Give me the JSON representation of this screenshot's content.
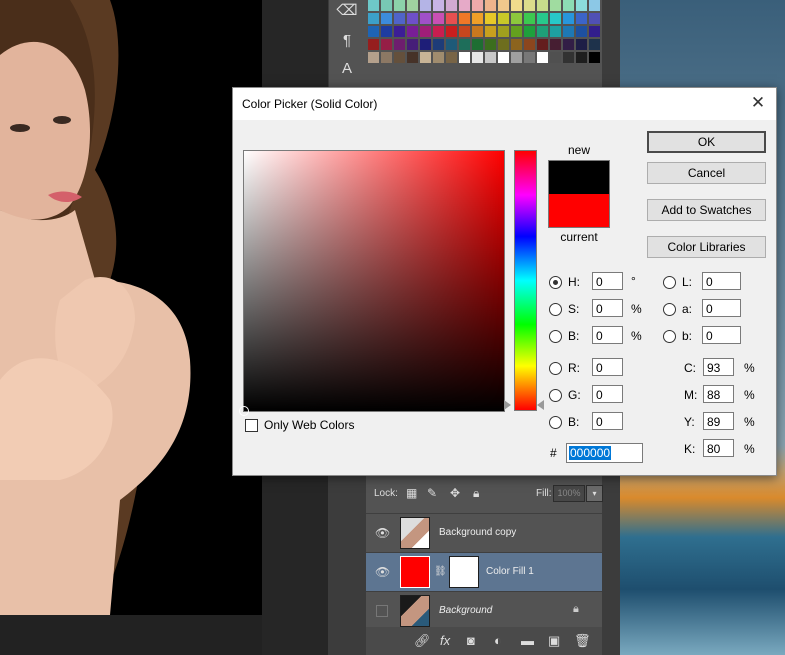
{
  "dialog": {
    "title": "Color Picker (Solid Color)",
    "ok_label": "OK",
    "cancel_label": "Cancel",
    "add_swatches_label": "Add to Swatches",
    "color_libraries_label": "Color Libraries",
    "new_label": "new",
    "current_label": "current",
    "new_color": "#000000",
    "current_color": "#ff0000",
    "only_web_colors_label": "Only Web Colors",
    "only_web_colors_checked": false,
    "hex_hash": "#",
    "hex_value": "000000",
    "selected_mode": "H",
    "hsb": {
      "h_label": "H:",
      "h_value": "0",
      "h_unit": "°",
      "s_label": "S:",
      "s_value": "0",
      "s_unit": "%",
      "b_label": "B:",
      "b_value": "0",
      "b_unit": "%"
    },
    "rgb": {
      "r_label": "R:",
      "r_value": "0",
      "g_label": "G:",
      "g_value": "0",
      "b_label": "B:",
      "b_value": "0"
    },
    "lab": {
      "l_label": "L:",
      "l_value": "0",
      "a_label": "a:",
      "a_value": "0",
      "b_label": "b:",
      "b_value": "0"
    },
    "cmyk": {
      "c_label": "C:",
      "c_value": "93",
      "m_label": "M:",
      "m_value": "88",
      "y_label": "Y:",
      "y_value": "89",
      "k_label": "K:",
      "k_value": "80",
      "unit": "%"
    }
  },
  "layers": {
    "lock_label": "Lock:",
    "fill_label": "Fill:",
    "fill_value": "100%",
    "items": [
      {
        "name": "Background copy",
        "visible": true,
        "selected": false
      },
      {
        "name": "Color Fill 1",
        "visible": true,
        "selected": true,
        "fill_color": "#ff0000"
      },
      {
        "name": "Background",
        "visible": false,
        "selected": false,
        "locked": true
      }
    ]
  },
  "footer_icons": [
    "link-icon",
    "fx-icon",
    "mask-icon",
    "adjustment-icon",
    "folder-icon",
    "new-layer-icon",
    "trash-icon"
  ],
  "swatches": [
    "#6ec8c8",
    "#78c8b4",
    "#8cd2aa",
    "#a0d2a0",
    "#b4b4e6",
    "#c8b4e6",
    "#d2aad2",
    "#e6aac8",
    "#f0aaaa",
    "#f0b48c",
    "#f0c88c",
    "#f0dc8c",
    "#dcdc8c",
    "#c8dc8c",
    "#a0dca0",
    "#8cdcb4",
    "#8cdcdc",
    "#8cc8e6",
    "#3ca0c8",
    "#3c8cdc",
    "#5064c8",
    "#6e50c8",
    "#a050c8",
    "#c850b4",
    "#e65050",
    "#f07828",
    "#f0a028",
    "#e6c828",
    "#c8c828",
    "#8cc83c",
    "#3cc850",
    "#28c88c",
    "#28c8c8",
    "#2896dc",
    "#3c64c8",
    "#5050b4",
    "#1e64b4",
    "#1e3ca0",
    "#3c1e96",
    "#781e96",
    "#a01e78",
    "#c81e50",
    "#c81e1e",
    "#c8461e",
    "#c8781e",
    "#c8a01e",
    "#a0a01e",
    "#64a01e",
    "#1ea03c",
    "#1ea078",
    "#1ea0a0",
    "#1e78b4",
    "#1e50a0",
    "#321e8c",
    "#961e1e",
    "#961e46",
    "#6e1e6e",
    "#461e78",
    "#1e1e78",
    "#1e3c78",
    "#1e5a78",
    "#1e6e5a",
    "#1e6e32",
    "#3c6e1e",
    "#6e6e1e",
    "#8c641e",
    "#8c461e",
    "#641e1e",
    "#461e32",
    "#321e46",
    "#1e1e46",
    "#1e324b",
    "#b4a08c",
    "#8c7864",
    "#64503c",
    "#463228",
    "#c8b496",
    "#a08c6e",
    "#786446",
    "#ffffff",
    "#e6e6e6",
    "#c8c8c8",
    "#ffffff",
    "#a0a0a0",
    "#787878",
    "#ffffff",
    "#505050",
    "#323232",
    "#1e1e1e",
    "#000000"
  ]
}
